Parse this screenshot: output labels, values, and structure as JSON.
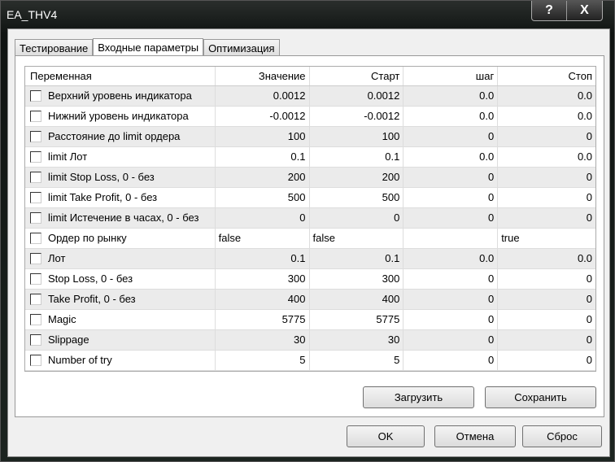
{
  "window": {
    "title": "EA_THV4",
    "help": "?",
    "close": "X"
  },
  "tabs": [
    "Тестирование",
    "Входные параметры",
    "Оптимизация"
  ],
  "headers": [
    "Переменная",
    "Значение",
    "Старт",
    "шаг",
    "Стоп"
  ],
  "rows": [
    [
      "Верхний уровень индикатора",
      "0.0012",
      "0.0012",
      "0.0",
      "0.0"
    ],
    [
      "Нижний уровень индикатора",
      "-0.0012",
      "-0.0012",
      "0.0",
      "0.0"
    ],
    [
      "Расстояние до limit ордера",
      "100",
      "100",
      "0",
      "0"
    ],
    [
      "limit Лот",
      "0.1",
      "0.1",
      "0.0",
      "0.0"
    ],
    [
      "limit Stop Loss, 0 - без",
      "200",
      "200",
      "0",
      "0"
    ],
    [
      "limit Take Profit, 0 - без",
      "500",
      "500",
      "0",
      "0"
    ],
    [
      "limit Истечение в часах, 0 - без",
      "0",
      "0",
      "0",
      "0"
    ],
    [
      "Ордер по рынку",
      "false",
      "false",
      "",
      "true"
    ],
    [
      "Лот",
      "0.1",
      "0.1",
      "0.0",
      "0.0"
    ],
    [
      "Stop Loss, 0 - без",
      "300",
      "300",
      "0",
      "0"
    ],
    [
      "Take Profit, 0 - без",
      "400",
      "400",
      "0",
      "0"
    ],
    [
      "Magic",
      "5775",
      "5775",
      "0",
      "0"
    ],
    [
      "Slippage",
      "30",
      "30",
      "0",
      "0"
    ],
    [
      "Number of try",
      "5",
      "5",
      "0",
      "0"
    ]
  ],
  "buttons": {
    "load": "Загрузить",
    "save": "Сохранить",
    "ok": "OK",
    "cancel": "Отмена",
    "reset": "Сброс"
  }
}
